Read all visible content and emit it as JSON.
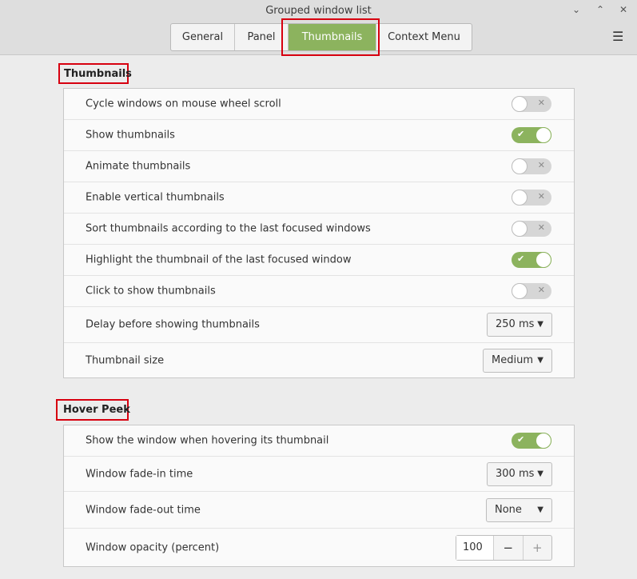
{
  "window": {
    "title": "Grouped window list",
    "minimize": "⌄",
    "maximize": "⌃",
    "close": "✕",
    "menu": "☰"
  },
  "tabs": [
    {
      "label": "General",
      "active": false
    },
    {
      "label": "Panel",
      "active": false
    },
    {
      "label": "Thumbnails",
      "active": true
    },
    {
      "label": "Context Menu",
      "active": false
    }
  ],
  "sections": {
    "thumbnails": {
      "title": "Thumbnails",
      "rows": [
        {
          "label": "Cycle windows on mouse wheel scroll",
          "type": "switch",
          "on": false
        },
        {
          "label": "Show thumbnails",
          "type": "switch",
          "on": true
        },
        {
          "label": "Animate thumbnails",
          "type": "switch",
          "on": false
        },
        {
          "label": "Enable vertical thumbnails",
          "type": "switch",
          "on": false
        },
        {
          "label": "Sort thumbnails according to the last focused windows",
          "type": "switch",
          "on": false
        },
        {
          "label": "Highlight the thumbnail of the last focused window",
          "type": "switch",
          "on": true
        },
        {
          "label": "Click to show thumbnails",
          "type": "switch",
          "on": false
        },
        {
          "label": "Delay before showing thumbnails",
          "type": "dropdown",
          "value": "250 ms"
        },
        {
          "label": "Thumbnail size",
          "type": "dropdown",
          "value": "Medium"
        }
      ]
    },
    "hover_peek": {
      "title": "Hover Peek",
      "rows": [
        {
          "label": "Show the window when hovering its thumbnail",
          "type": "switch",
          "on": true
        },
        {
          "label": "Window fade-in time",
          "type": "dropdown",
          "value": "300 ms"
        },
        {
          "label": "Window fade-out time",
          "type": "dropdown",
          "value": "None"
        },
        {
          "label": "Window opacity (percent)",
          "type": "spin",
          "value": "100",
          "minus": "−",
          "plus": "+"
        }
      ]
    }
  },
  "glyphs": {
    "switch_on": "✔",
    "switch_off": "✕",
    "dropdown_arrow": "▼"
  },
  "colors": {
    "accent": "#8cb35e",
    "highlight_box": "#d7000f"
  }
}
